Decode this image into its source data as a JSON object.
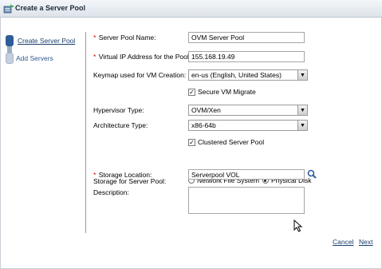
{
  "window": {
    "title": "Create a Server Pool"
  },
  "train": {
    "steps": [
      {
        "label": "Create Server Pool",
        "active": true
      },
      {
        "label": "Add Servers",
        "active": false
      }
    ]
  },
  "form": {
    "server_pool_name": {
      "label": "Server Pool Name:",
      "value": "OVM Server Pool",
      "required": "*"
    },
    "virtual_ip": {
      "label": "Virtual IP Address for the Pool:",
      "value": "155.168.19.49",
      "required": "*"
    },
    "keymap": {
      "label": "Keymap used for VM Creation:",
      "value": "en-us (English, United States)"
    },
    "secure_vm_migrate": {
      "label": "Secure VM Migrate",
      "checked": true
    },
    "hypervisor_type": {
      "label": "Hypervisor Type:",
      "value": "OVM/Xen"
    },
    "architecture_type": {
      "label": "Architecture Type:",
      "value": "x86-64b"
    },
    "clustered_server_pool": {
      "label": "Clustered Server Pool",
      "checked": true
    },
    "storage_for_pool": {
      "label": "Storage for Server Pool:",
      "options": [
        "Network File System",
        "Physical Disk"
      ],
      "selected": "Physical Disk"
    },
    "storage_location": {
      "label": "Storage Location:",
      "value": "Serverpool VOL",
      "required": "*"
    },
    "description": {
      "label": "Description:",
      "value": ""
    }
  },
  "footer": {
    "cancel_label": "Cancel",
    "next_label": "Next"
  },
  "colors": {
    "link": "#1b3f6e",
    "required": "#cc0000",
    "titlebar": "#dde3ea"
  }
}
